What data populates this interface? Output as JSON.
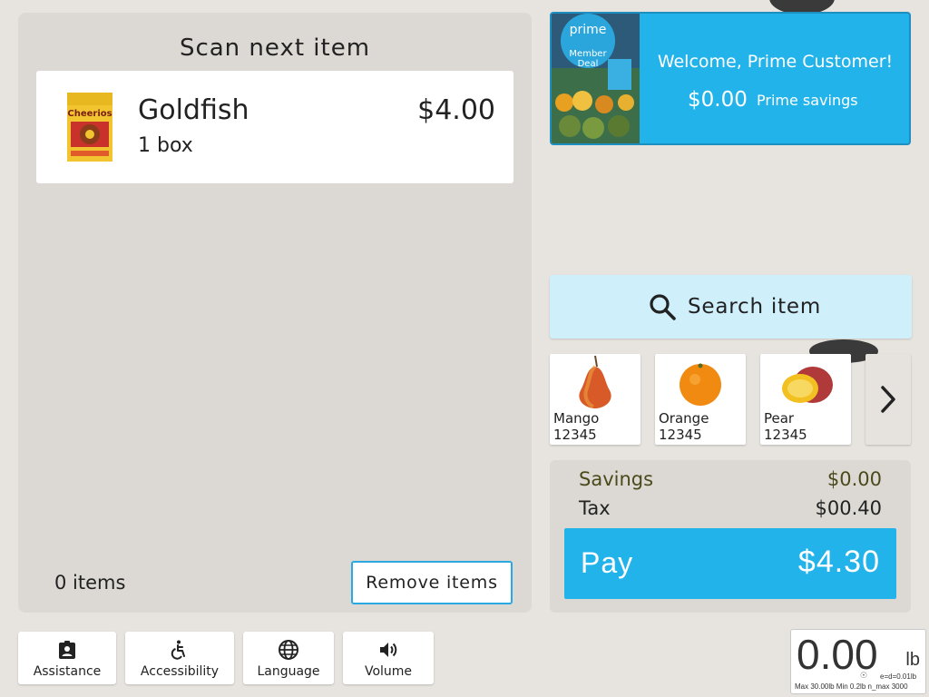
{
  "cart": {
    "title": "Scan next item",
    "items": [
      {
        "name": "Goldfish",
        "quantity": "1 box",
        "price": "$4.00",
        "thumbnail": "cereal-box-thumbnail",
        "thumbnail_text": "Cheerios"
      }
    ],
    "items_count": "0 items",
    "remove_label": "Remove items"
  },
  "prime": {
    "image": "prime-member-deal-produce-photo",
    "image_text_brand": "prime",
    "image_text_line1": "Member",
    "image_text_line2": "Deal",
    "welcome": "Welcome, Prime Customer!",
    "savings_amount": "$0.00",
    "savings_label": "Prime savings"
  },
  "search": {
    "label": "Search item",
    "icon": "search-icon"
  },
  "produce": [
    {
      "name": "Mango",
      "code": "12345",
      "image": "pear-image"
    },
    {
      "name": "Orange",
      "code": "12345",
      "image": "orange-image"
    },
    {
      "name": "Pear",
      "code": "12345",
      "image": "mango-image"
    }
  ],
  "produce_next_icon": "chevron-right-icon",
  "totals": {
    "savings_label": "Savings",
    "savings_value": "$0.00",
    "tax_label": "Tax",
    "tax_value": "$00.40",
    "pay_label": "Pay",
    "pay_amount": "$4.30"
  },
  "toolbar": [
    {
      "label": "Assistance",
      "icon": "assistance-badge-icon"
    },
    {
      "label": "Accessibility",
      "icon": "accessibility-icon"
    },
    {
      "label": "Language",
      "icon": "globe-icon"
    },
    {
      "label": "Volume",
      "icon": "volume-icon"
    }
  ],
  "scale": {
    "value": "0.00",
    "unit": "lb",
    "division": "e=d=0.01lb",
    "specs": "Max 30.00lb  Min 0.2lb  n_max 3000"
  },
  "colors": {
    "accent": "#23b3eb",
    "search_bg": "#cfeffb",
    "panel_bg": "#dcd9d5",
    "savings_text": "#4a4a1a"
  }
}
